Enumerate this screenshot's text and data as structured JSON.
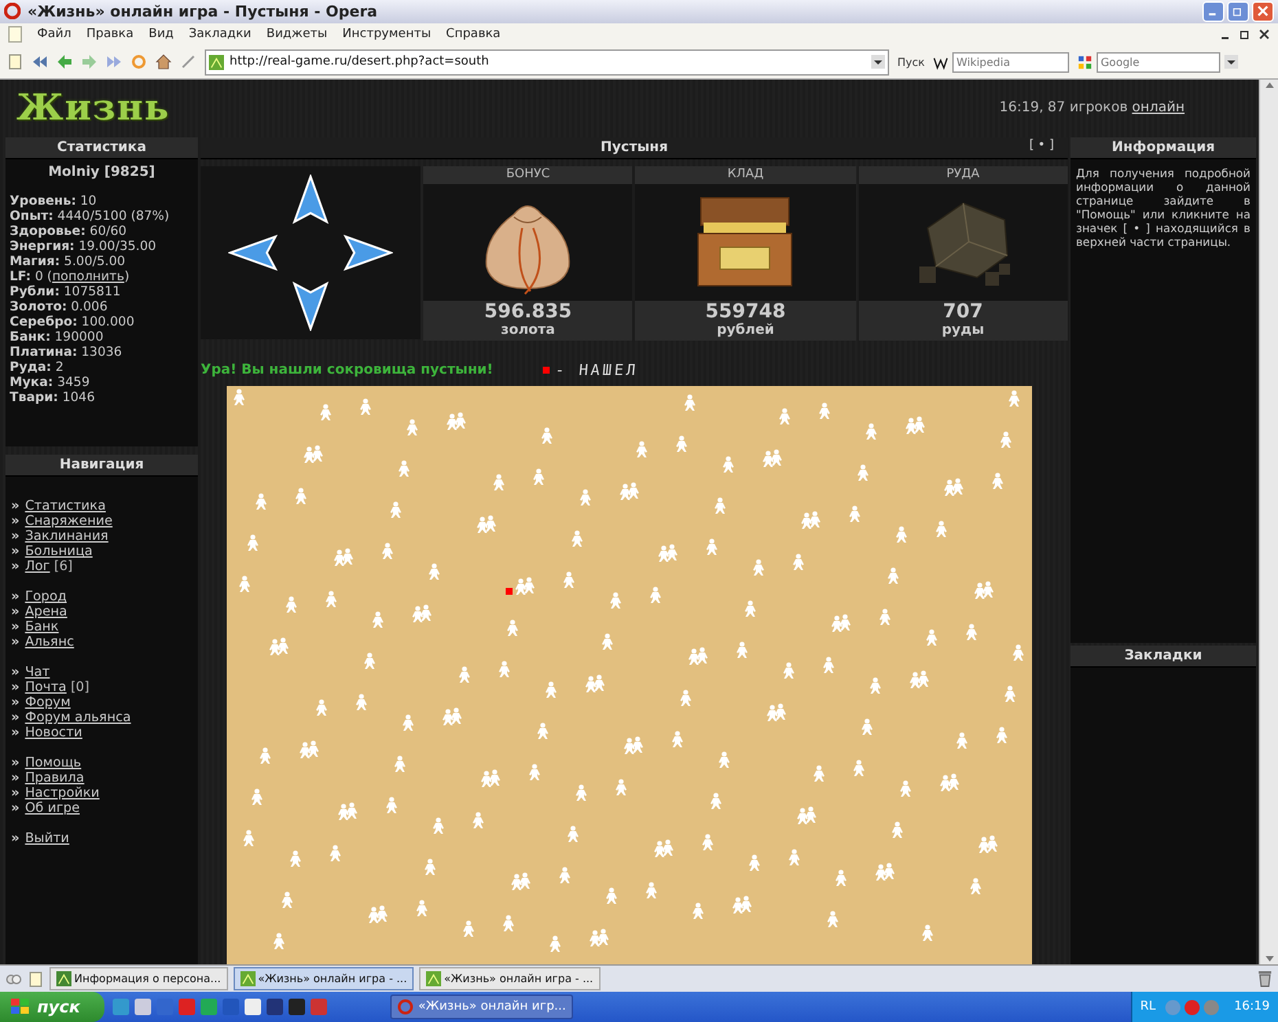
{
  "window": {
    "title": "«Жизнь» онлайн игра - Пустыня - Opera"
  },
  "menu": [
    "Файл",
    "Правка",
    "Вид",
    "Закладки",
    "Виджеты",
    "Инструменты",
    "Справка"
  ],
  "address": {
    "url": "http://real-game.ru/desert.php?act=south",
    "go_label": "Пуск",
    "search1_placeholder": "Wikipedia",
    "search2_placeholder": "Google"
  },
  "site": {
    "logo": "Жизнь",
    "status_text": "16:19, 87 игроков",
    "status_link": "онлайн"
  },
  "stats": {
    "title": "Статистика",
    "player": "Molniy [9825]",
    "rows": [
      {
        "label": "Уровень:",
        "value": "10"
      },
      {
        "label": "Опыт:",
        "value": "4440/5100 (87%)"
      },
      {
        "label": "Здоровье:",
        "value": "60/60"
      },
      {
        "label": "Энергия:",
        "value": "19.00/35.00"
      },
      {
        "label": "Магия:",
        "value": "5.00/5.00"
      },
      {
        "label": "LF:",
        "value": "0 (",
        "link": "пополнить",
        "after": ")"
      },
      {
        "label": "Рубли:",
        "value": "1075811"
      },
      {
        "label": "Золото:",
        "value": "0.006"
      },
      {
        "label": "Серебро:",
        "value": "100.000"
      },
      {
        "label": "Банк:",
        "value": "190000"
      },
      {
        "label": "Платина:",
        "value": "13036"
      },
      {
        "label": "Руда:",
        "value": "2"
      },
      {
        "label": "Мука:",
        "value": "3459"
      },
      {
        "label": "Твари:",
        "value": "1046"
      }
    ]
  },
  "navigation": {
    "title": "Навигация",
    "bullet": "»",
    "groups": [
      [
        {
          "label": "Статистика"
        },
        {
          "label": "Снаряжение"
        },
        {
          "label": "Заклинания"
        },
        {
          "label": "Больница"
        },
        {
          "label": "Лог",
          "count": "[6]"
        }
      ],
      [
        {
          "label": "Город"
        },
        {
          "label": "Арена"
        },
        {
          "label": "Банк"
        },
        {
          "label": "Альянс"
        }
      ],
      [
        {
          "label": "Чат"
        },
        {
          "label": "Почта",
          "count": "[0]"
        },
        {
          "label": "Форум"
        },
        {
          "label": "Форум альянса"
        },
        {
          "label": "Новости"
        }
      ],
      [
        {
          "label": "Помощь"
        },
        {
          "label": "Правила"
        },
        {
          "label": "Настройки"
        },
        {
          "label": "Об игре"
        }
      ],
      [
        {
          "label": "Выйти"
        }
      ]
    ]
  },
  "desert": {
    "title": "Пустыня",
    "help_button": "[ • ]",
    "rewards": [
      {
        "title": "БОНУС",
        "kind": "bag",
        "amount": "596.835",
        "unit": "золота"
      },
      {
        "title": "КЛАД",
        "kind": "chest",
        "amount": "559748",
        "unit": "рублей"
      },
      {
        "title": "РУДА",
        "kind": "ore",
        "amount": "707",
        "unit": "руды"
      }
    ],
    "message": "Ура! Вы нашли сокровища пустыни!",
    "legend_text": "- НАШЕЛ"
  },
  "info": {
    "title": "Информация",
    "text": "Для получения подробной информации о данной странице зайдите в \"Помощь\" или кликните на значек [ • ] находящийся в верхней части страницы."
  },
  "bookmarks": {
    "title": "Закладки"
  },
  "browser_tabs": [
    {
      "label": "Информация о персона...",
      "selected": false
    },
    {
      "label": "«Жизнь» онлайн игра - ...",
      "selected": true
    },
    {
      "label": "«Жизнь» онлайн игра - ...",
      "selected": false
    }
  ],
  "taskbar": {
    "start": "пуск",
    "window": "«Жизнь» онлайн игр...",
    "tray_lang": "RL",
    "clock": "16:19"
  }
}
